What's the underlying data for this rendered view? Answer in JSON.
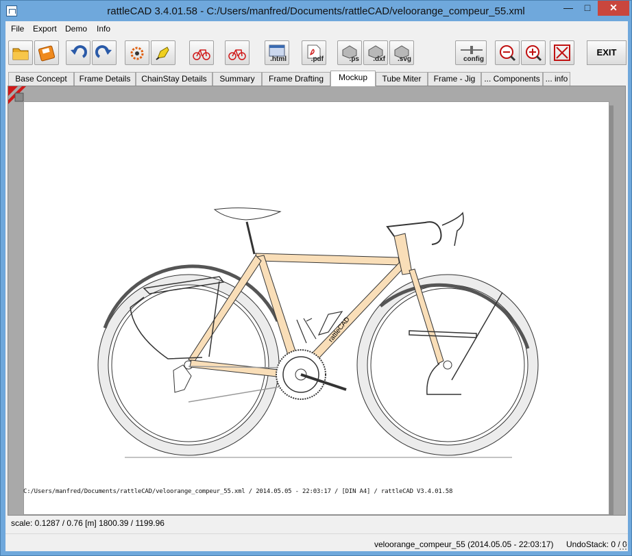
{
  "window": {
    "title": "rattleCAD  3.4.01.58 - C:/Users/manfred/Documents/rattleCAD/veloorange_compeur_55.xml",
    "minimize": "—",
    "maximize": "□",
    "close": "✕"
  },
  "menu": {
    "file": "File",
    "export": "Export",
    "demo": "Demo",
    "info": "Info"
  },
  "toolbar": {
    "html_label": ".html",
    "pdf_label": ".pdf",
    "ps_label": ".ps",
    "dxf_label": ".dxf",
    "svg_label": ".svg",
    "config_label": "config",
    "exit_label": "EXIT"
  },
  "tabs": [
    {
      "label": "Base Concept"
    },
    {
      "label": "Frame Details"
    },
    {
      "label": "ChainStay Details"
    },
    {
      "label": "Summary"
    },
    {
      "label": "Frame Drafting"
    },
    {
      "label": "Mockup"
    },
    {
      "label": "Tube Miter"
    },
    {
      "label": "Frame - Jig"
    },
    {
      "label": "... Components"
    },
    {
      "label": "... info"
    }
  ],
  "active_tab": "Mockup",
  "drawing": {
    "footer": "C:/Users/manfred/Documents/rattleCAD/veloorange_compeur_55.xml   /   2014.05.05 - 22:03:17   /  [DIN A4]  /  rattleCAD   V3.4.01.58",
    "down_tube_decal": "rattleCAD",
    "frame_color": "#f9deb8"
  },
  "scale_bar": {
    "text": "scale: 0.1287 / 0.76  [m]   1800.39 / 1199.96"
  },
  "status": {
    "file": "veloorange_compeur_55 (2014.05.05 - 22:03:17)",
    "undo": "UndoStack:  0 / 0"
  }
}
